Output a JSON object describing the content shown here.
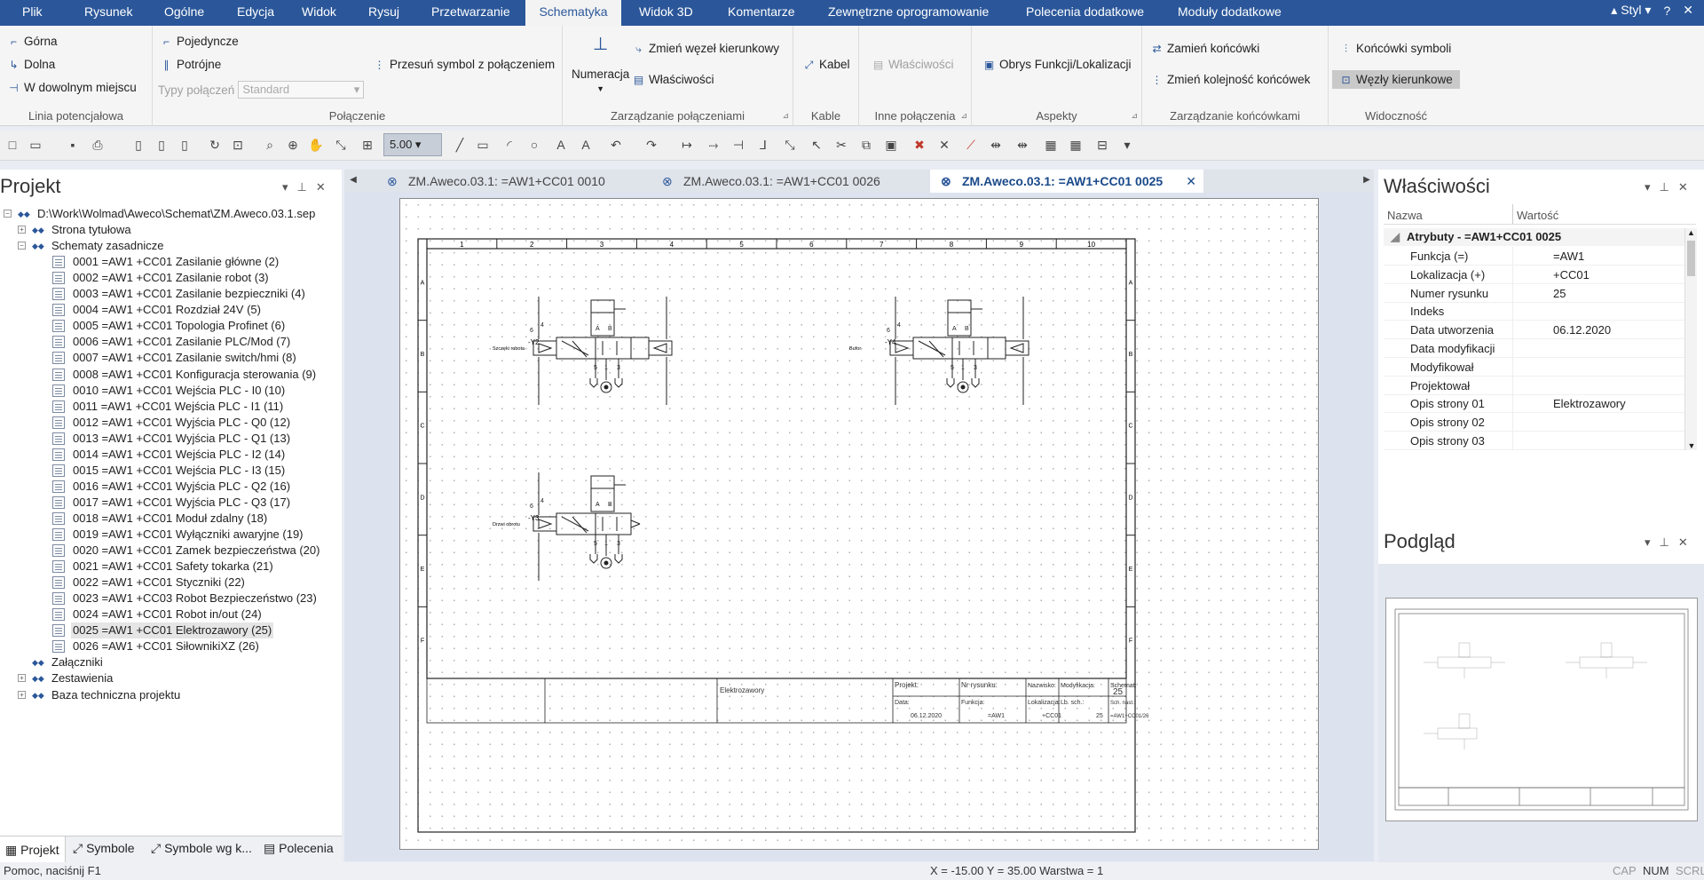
{
  "menu": [
    "Plik",
    "Rysunek",
    "Ogólne",
    "Edycja",
    "Widok",
    "Rysuj",
    "Przetwarzanie",
    "Schematyka",
    "Widok 3D",
    "Komentarze",
    "Zewnętrzne oprogramowanie",
    "Polecenia dodatkowe",
    "Moduły dodatkowe"
  ],
  "menu_active": "Schematyka",
  "style_label": "Styl",
  "ribbon": {
    "g1": {
      "label": "Linia potencjałowa",
      "b1": "Górna",
      "b2": "Dolna",
      "b3": "W dowolnym miejscu"
    },
    "g2": {
      "label": "Połączenie",
      "b1": "Pojedyncze",
      "b2": "Potrójne",
      "b3_label": "Typy połączeń",
      "b3_value": "Standard",
      "b4": "Przesuń symbol z połączeniem"
    },
    "g3": {
      "label": "Zarządzanie połączeniami",
      "b1": "Numeracja",
      "b2": "Zmień węzeł kierunkowy",
      "b3": "Właściwości"
    },
    "g4": {
      "label": "Kable",
      "b1": "Kabel"
    },
    "g5": {
      "label": "Inne połączenia",
      "b1": "Właściwości"
    },
    "g6": {
      "label": "Aspekty",
      "b1": "Obrys Funkcji/Lokalizacji"
    },
    "g7": {
      "label": "Zarządzanie końcówkami",
      "b1": "Zamień końcówki",
      "b2": "Zmień kolejność końcówek"
    },
    "g8": {
      "label": "Widoczność",
      "b1": "Końcówki symboli",
      "b2": "Węzły kierunkowe"
    }
  },
  "toolbar": {
    "size_value": "5.00"
  },
  "project": {
    "title": "Projekt",
    "root": "D:\\Work\\Wolmad\\Aweco\\Schemat\\ZM.Aweco.03.1.sep",
    "folders": {
      "f1": "Strona tytułowa",
      "f2": "Schematy zasadnicze",
      "f3": "Załączniki",
      "f4": "Zestawienia",
      "f5": "Baza techniczna projektu"
    },
    "pages": [
      "0001 =AW1 +CC01 Zasilanie główne (2)",
      "0002 =AW1 +CC01 Zasilanie robot (3)",
      "0003 =AW1 +CC01 Zasilanie bezpieczniki (4)",
      "0004 =AW1 +CC01 Rozdział 24V (5)",
      "0005 =AW1 +CC01 Topologia Profinet (6)",
      "0006 =AW1 +CC01 Zasilanie PLC/Mod (7)",
      "0007 =AW1 +CC01 Zasilanie switch/hmi (8)",
      "0008 =AW1 +CC01 Konfiguracja sterowania (9)",
      "0010 =AW1 +CC01 Wejścia PLC - I0 (10)",
      "0011 =AW1 +CC01 Wejścia PLC - I1 (11)",
      "0012 =AW1 +CC01 Wyjścia PLC - Q0 (12)",
      "0013 =AW1 +CC01 Wyjścia PLC - Q1 (13)",
      "0014 =AW1 +CC01 Wejścia PLC - I2 (14)",
      "0015 =AW1 +CC01 Wejścia PLC - I3 (15)",
      "0016 =AW1 +CC01 Wyjścia PLC - Q2 (16)",
      "0017 =AW1 +CC01 Wyjścia PLC - Q3 (17)",
      "0018 =AW1 +CC01 Moduł zdalny (18)",
      "0019 =AW1 +CC01 Wyłączniki awaryjne (19)",
      "0020 =AW1 +CC01 Zamek bezpieczeństwa (20)",
      "0021 =AW1 +CC01 Safety tokarka (21)",
      "0022 =AW1 +CC01 Styczniki (22)",
      "0023 =AW1 +CC03 Robot Bezpieczeństwo (23)",
      "0024 =AW1 +CC01 Robot in/out (24)",
      "0025 =AW1 +CC01 Elektrozawory (25)",
      "0026 =AW1 +CC01 SiłownikiXZ (26)"
    ]
  },
  "bottom_tabs": [
    "Projekt",
    "Symbole",
    "Symbole wg k...",
    "Polecenia"
  ],
  "doc_tabs": [
    "ZM.Aweco.03.1: =AW1+CC01 0010",
    "ZM.Aweco.03.1: =AW1+CC01 0026",
    "ZM.Aweco.03.1: =AW1+CC01 0025"
  ],
  "drawing": {
    "columns": [
      "1",
      "2",
      "3",
      "4",
      "5",
      "6",
      "7",
      "8",
      "9",
      "10"
    ],
    "rows": [
      "A",
      "B",
      "C",
      "D",
      "E",
      "F"
    ],
    "valves": [
      {
        "tag": "-Y2",
        "name": "Szczęki robota"
      },
      {
        "tag": "-Y4",
        "name": "Bufor"
      },
      {
        "tag": "-Y3",
        "name": "Drzwi obrotu"
      }
    ],
    "title_block": {
      "description": "Elektrozawory",
      "project_label": "Projekt:",
      "drawing_no_label": "Nr rysunku:",
      "surname_label": "Nazwisko:",
      "modification_label": "Modyfikacja:",
      "sheet_label": "Schemat:",
      "sheet_value": "25",
      "date_label": "Data:",
      "date_value": "06.12.2020",
      "function_label": "Funkcja:",
      "function_value": "=AW1",
      "location_label": "Lokalizacja:",
      "location_value": "+CC01",
      "count_label": "Lb. sch.:",
      "count_value": "25",
      "next_label": "Sch. nast.:",
      "next_value": "=AW1+CC01/26"
    }
  },
  "properties": {
    "title": "Właściwości",
    "col_name": "Nazwa",
    "col_value": "Wartość",
    "group": "Atrybuty - =AW1+CC01 0025",
    "rows": [
      {
        "name": "Funkcja (=)",
        "value": "=AW1"
      },
      {
        "name": "Lokalizacja (+)",
        "value": "+CC01"
      },
      {
        "name": "Numer rysunku",
        "value": "25"
      },
      {
        "name": "Indeks",
        "value": ""
      },
      {
        "name": "Data utworzenia",
        "value": "06.12.2020"
      },
      {
        "name": "Data modyfikacji",
        "value": ""
      },
      {
        "name": "Modyfikował",
        "value": ""
      },
      {
        "name": "Projektował",
        "value": ""
      },
      {
        "name": "Opis strony 01",
        "value": "Elektrozawory"
      },
      {
        "name": "Opis strony 02",
        "value": ""
      },
      {
        "name": "Opis strony 03",
        "value": ""
      }
    ]
  },
  "preview": {
    "title": "Podgląd"
  },
  "status": {
    "help": "Pomoc, naciśnij F1",
    "coords": "X = -15.00  Y = 35.00 Warstwa = 1",
    "cap": "CAP",
    "num": "NUM",
    "scrl": "SCRL"
  }
}
